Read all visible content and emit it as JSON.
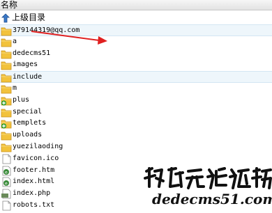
{
  "header": {
    "label": "名称"
  },
  "updir": {
    "label": "上级目录"
  },
  "files": [
    {
      "name": "379144319@qq.com",
      "kind": "folder",
      "highlight": true
    },
    {
      "name": "a",
      "kind": "folder"
    },
    {
      "name": "dedecms51",
      "kind": "folder"
    },
    {
      "name": "images",
      "kind": "folder"
    },
    {
      "name": "include",
      "kind": "folder",
      "highlight": true
    },
    {
      "name": "m",
      "kind": "folder"
    },
    {
      "name": "plus",
      "kind": "folder-plus"
    },
    {
      "name": "special",
      "kind": "folder"
    },
    {
      "name": "templets",
      "kind": "folder-plus"
    },
    {
      "name": "uploads",
      "kind": "folder"
    },
    {
      "name": "yuezilaoding",
      "kind": "folder"
    },
    {
      "name": "favicon.ico",
      "kind": "file"
    },
    {
      "name": "footer.htm",
      "kind": "html"
    },
    {
      "name": "index.html",
      "kind": "html"
    },
    {
      "name": "index.php",
      "kind": "php"
    },
    {
      "name": "robots.txt",
      "kind": "file"
    }
  ],
  "watermark": {
    "text": "织梦无忧论坛",
    "url": "dedecms51.com"
  },
  "colors": {
    "arrow": "#e02020",
    "folder": "#f0c040",
    "highlight": "#eef6fb"
  }
}
